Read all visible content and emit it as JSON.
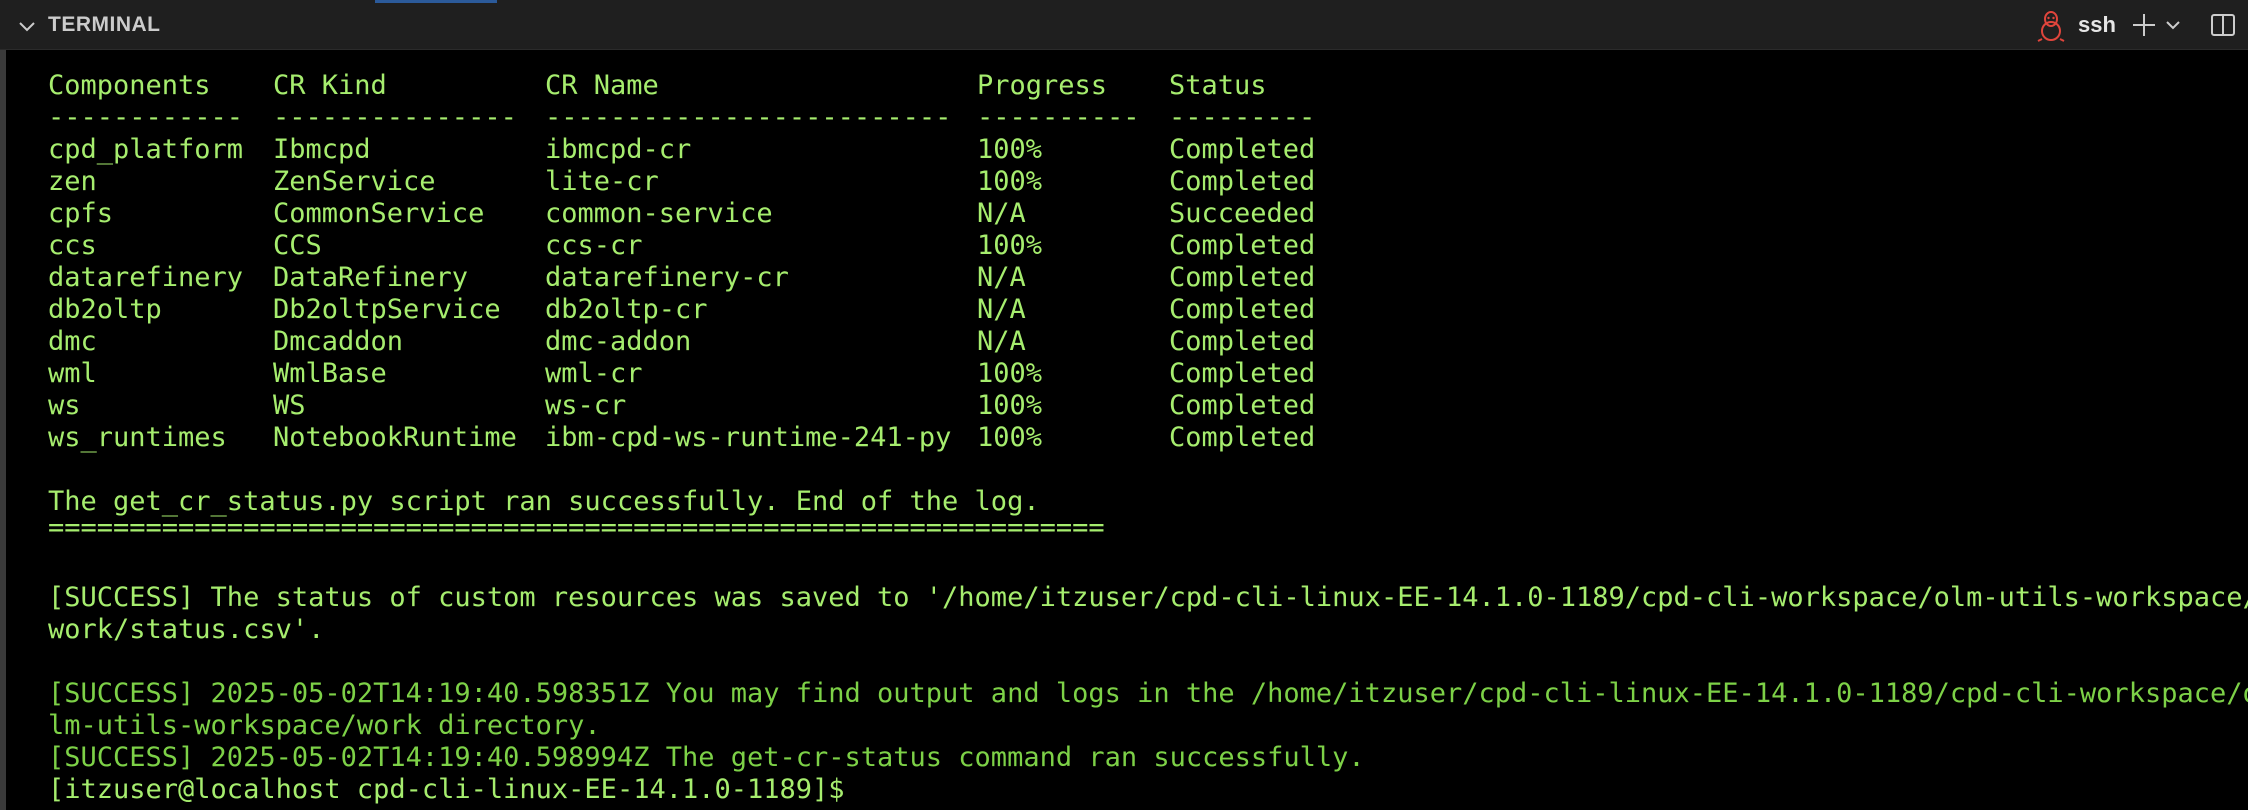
{
  "header": {
    "title": "TERMINAL",
    "shell_name": "ssh",
    "icons": {
      "collapse": "chevron-down-icon",
      "profile": "linux-icon",
      "new_terminal": "plus-icon",
      "dropdown": "chevron-down-icon",
      "panel": "split-panel-icon"
    }
  },
  "table": {
    "headers": [
      "Components",
      "CR Kind",
      "CR Name",
      "Progress",
      "Status"
    ],
    "separators": [
      "------------",
      "---------------",
      "-------------------------",
      "----------",
      "---------"
    ],
    "rows": [
      [
        "cpd_platform",
        "Ibmcpd",
        "ibmcpd-cr",
        "100%",
        "Completed"
      ],
      [
        "zen",
        "ZenService",
        "lite-cr",
        "100%",
        "Completed"
      ],
      [
        "cpfs",
        "CommonService",
        "common-service",
        "N/A",
        "Succeeded"
      ],
      [
        "ccs",
        "CCS",
        "ccs-cr",
        "100%",
        "Completed"
      ],
      [
        "datarefinery",
        "DataRefinery",
        "datarefinery-cr",
        "N/A",
        "Completed"
      ],
      [
        "db2oltp",
        "Db2oltpService",
        "db2oltp-cr",
        "N/A",
        "Completed"
      ],
      [
        "dmc",
        "Dmcaddon",
        "dmc-addon",
        "N/A",
        "Completed"
      ],
      [
        "wml",
        "WmlBase",
        "wml-cr",
        "100%",
        "Completed"
      ],
      [
        "ws",
        "WS",
        "ws-cr",
        "100%",
        "Completed"
      ],
      [
        "ws_runtimes",
        "NotebookRuntime",
        "ibm-cpd-ws-runtime-241-py",
        "100%",
        "Completed"
      ]
    ]
  },
  "output": {
    "script_message": "The get_cr_status.py script ran successfully. End of the log.",
    "divider": "=================================================================",
    "saved_line_1": "[SUCCESS] The status of custom resources was saved to '/home/itzuser/cpd-cli-linux-EE-14.1.0-1189/cpd-cli-workspace/olm-utils-workspace/",
    "saved_line_2": "work/status.csv'.",
    "logs_line_1": "[SUCCESS] 2025-05-02T14:19:40.598351Z You may find output and logs in the /home/itzuser/cpd-cli-linux-EE-14.1.0-1189/cpd-cli-workspace/o",
    "logs_line_2": "lm-utils-workspace/work directory.",
    "done_line": "[SUCCESS] 2025-05-02T14:19:40.598994Z The get-cr-status command ran successfully.",
    "prompt": "[itzuser@localhost cpd-cli-linux-EE-14.1.0-1189]$"
  },
  "colors": {
    "text": "#a6ed6e",
    "dim_text": "#7dd147",
    "background": "#000000",
    "header_bg": "#1f1f1f",
    "linux_icon": "#e0453c"
  }
}
